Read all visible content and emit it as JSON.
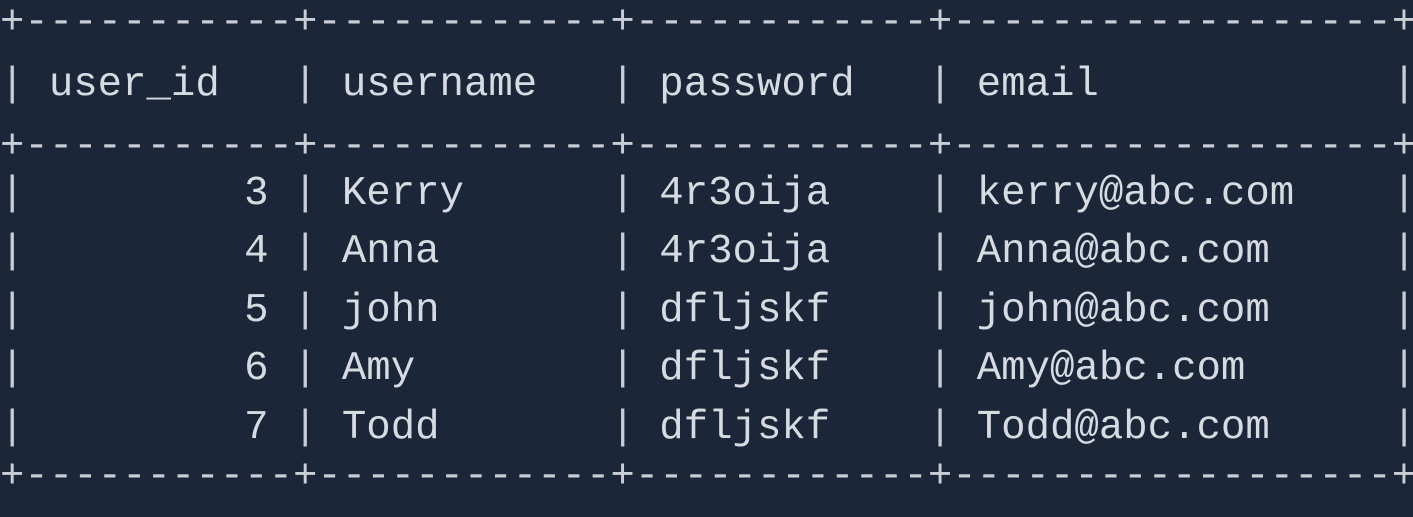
{
  "table": {
    "columns": [
      {
        "label": "user_id",
        "width": 9,
        "align": "right"
      },
      {
        "label": "username",
        "width": 10,
        "align": "left"
      },
      {
        "label": "password",
        "width": 10,
        "align": "left"
      },
      {
        "label": "email",
        "width": 16,
        "align": "left"
      }
    ],
    "rows": [
      [
        "3",
        "Kerry",
        "4r3oija",
        "kerry@abc.com"
      ],
      [
        "4",
        "Anna",
        "4r3oija",
        "Anna@abc.com"
      ],
      [
        "5",
        "john",
        "dfljskf",
        "john@abc.com"
      ],
      [
        "6",
        "Amy",
        "dfljskf",
        "Amy@abc.com"
      ],
      [
        "7",
        "Todd",
        "dfljskf",
        "Todd@abc.com"
      ]
    ]
  },
  "colors": {
    "background": "#1c2639",
    "text": "#d6dbe2",
    "border": "#c9ced6"
  }
}
